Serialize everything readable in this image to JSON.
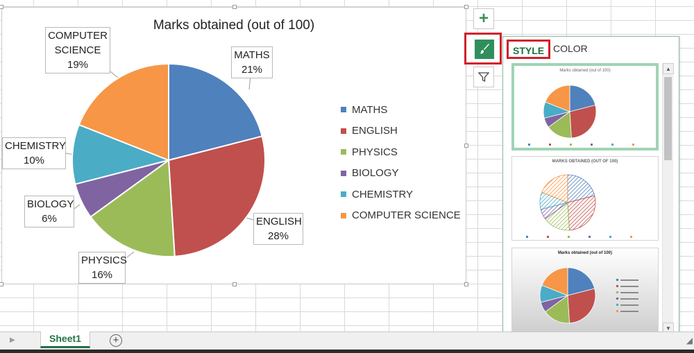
{
  "sheet": {
    "tab_label": "Sheet1",
    "add_sheet_symbol": "+",
    "nav_symbol": "▶"
  },
  "chart_data": {
    "type": "pie",
    "title": "Marks obtained (out of 100)",
    "categories": [
      "MATHS",
      "ENGLISH",
      "PHYSICS",
      "BIOLOGY",
      "CHEMISTRY",
      "COMPUTER SCIENCE"
    ],
    "values": [
      21,
      28,
      16,
      6,
      10,
      19
    ],
    "data_labels": [
      "21%",
      "28%",
      "16%",
      "6%",
      "10%",
      "19%"
    ],
    "colors": [
      "#4f81bd",
      "#c0504d",
      "#9bbb59",
      "#8064a2",
      "#4bacc6",
      "#f79646"
    ],
    "legend_position": "right"
  },
  "callouts": [
    {
      "lines": [
        "MATHS",
        "21%"
      ]
    },
    {
      "lines": [
        "ENGLISH",
        "28%"
      ]
    },
    {
      "lines": [
        "PHYSICS",
        "16%"
      ]
    },
    {
      "lines": [
        "BIOLOGY",
        "6%"
      ]
    },
    {
      "lines": [
        "CHEMISTRY",
        "10%"
      ]
    },
    {
      "lines": [
        "COMPUTER",
        "SCIENCE",
        "19%"
      ]
    }
  ],
  "chart_buttons": {
    "chart_elements": {
      "icon": "plus-icon",
      "symbol": "+"
    },
    "chart_styles": {
      "icon": "paintbrush-icon"
    },
    "chart_filters": {
      "icon": "funnel-icon"
    }
  },
  "style_panel": {
    "tabs": [
      "STYLE",
      "COLOR"
    ],
    "active_tab": "STYLE",
    "thumbnails": [
      {
        "title": "Marks obtained (out of 100)",
        "selected": true
      },
      {
        "title": "MARKS OBTAINED (OUT OF 100)",
        "selected": false
      },
      {
        "title": "Marks obtained (out of 100)",
        "selected": false
      }
    ],
    "scroll_up_symbol": "▲",
    "scroll_down_symbol": "▼"
  }
}
